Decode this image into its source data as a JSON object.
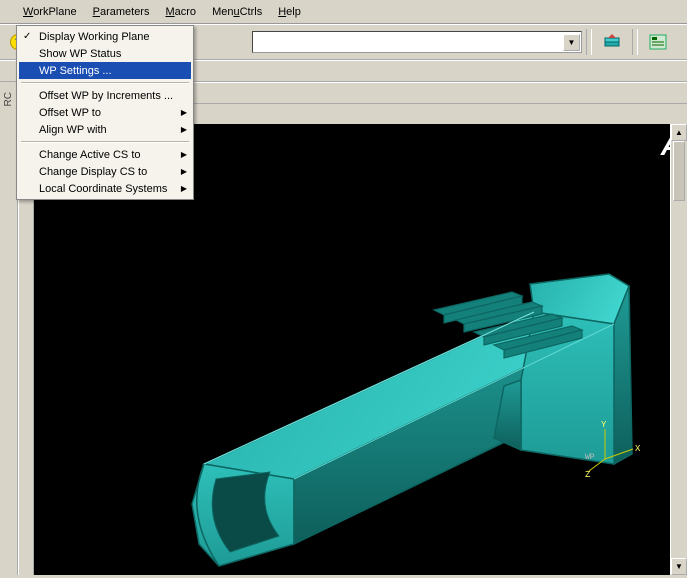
{
  "menubar": {
    "items": [
      "WorkPlane",
      "Parameters",
      "Macro",
      "MenuCtrls",
      "Help"
    ],
    "underlines": [
      "W",
      "P",
      "M",
      "u",
      "H"
    ]
  },
  "dropdown": {
    "items": [
      {
        "label": "Display Working Plane",
        "checked": true
      },
      {
        "label": "Show WP Status"
      },
      {
        "label": "WP Settings ...",
        "highlighted": true
      },
      {
        "sep": true
      },
      {
        "label": "Offset WP by Increments ..."
      },
      {
        "label": "Offset WP to",
        "submenu": true
      },
      {
        "label": "Align WP with",
        "submenu": true
      },
      {
        "sep": true
      },
      {
        "label": "Change Active CS to",
        "submenu": true
      },
      {
        "label": "Change Display CS to",
        "submenu": true
      },
      {
        "label": "Local Coordinate Systems",
        "submenu": true
      }
    ]
  },
  "toolbar": {
    "help_icon": "?"
  },
  "leftpanel": {
    "label": "RC"
  },
  "axis": {
    "x": "X",
    "y": "Y",
    "z": "Z",
    "wp": "WP"
  },
  "watermark": "A"
}
